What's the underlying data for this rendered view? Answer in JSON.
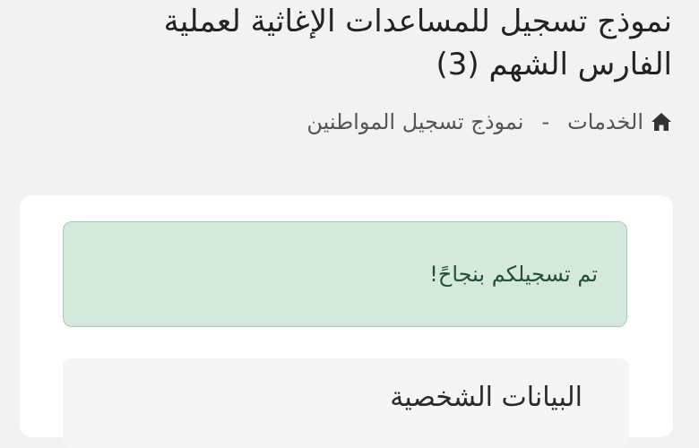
{
  "header": {
    "title_line1": "نموذج تسجيل للمساعدات الإغاثية لعملية",
    "title_line2": "الفارس الشهم (3)"
  },
  "breadcrumb": {
    "home_icon": "home-icon",
    "items": [
      "الخدمات",
      "نموذج تسجيل المواطنين"
    ],
    "separator": "-"
  },
  "alert": {
    "message": "تم تسجيلكم بنجاحً!",
    "bg_color": "#d4e9dc",
    "border_color": "#9fcfb0",
    "text_color": "#1f5132"
  },
  "section": {
    "title": "البيانات الشخصية"
  }
}
